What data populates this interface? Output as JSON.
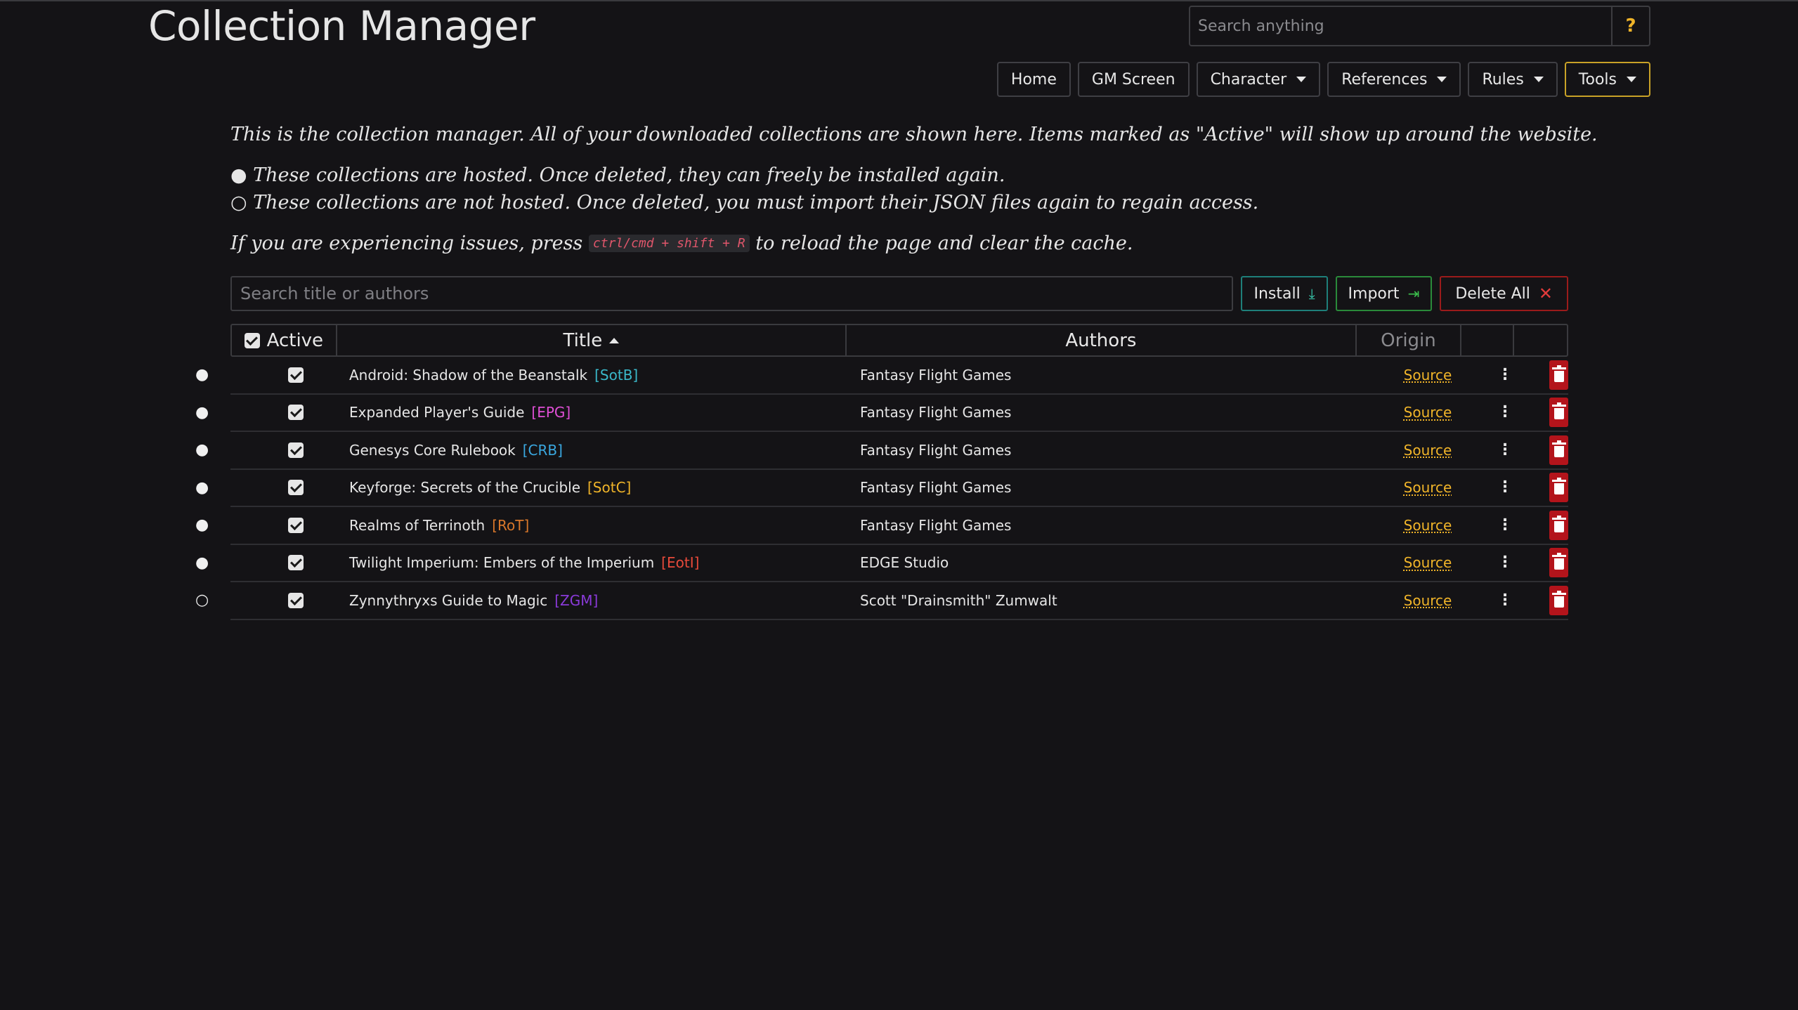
{
  "app": {
    "title": "Collection Manager",
    "search_placeholder": "Search anything",
    "help_label": "?"
  },
  "nav": {
    "items": [
      {
        "label": "Home",
        "dropdown": false
      },
      {
        "label": "GM Screen",
        "dropdown": false
      },
      {
        "label": "Character",
        "dropdown": true
      },
      {
        "label": "References",
        "dropdown": true
      },
      {
        "label": "Rules",
        "dropdown": true
      },
      {
        "label": "Tools",
        "dropdown": true,
        "active": true
      }
    ]
  },
  "intro": {
    "line1": "This is the collection manager. All of your downloaded collections are shown here. Items marked as \"Active\" will show up around the website.",
    "line2": "● These collections are hosted. Once deleted, they can freely be installed again.",
    "line3": "○ These collections are not hosted. Once deleted, you must import their JSON files again to regain access.",
    "line4_before": "If you are experiencing issues, press",
    "line4_key": "ctrl/cmd + shift + R",
    "line4_after": "to reload the page and clear the cache."
  },
  "toolbar": {
    "search_placeholder": "Search title or authors",
    "install_label": "Install",
    "import_label": "Import",
    "delete_all_label": "Delete All"
  },
  "table": {
    "headers": {
      "active": "Active",
      "title": "Title",
      "authors": "Authors",
      "origin": "Origin"
    },
    "rows": [
      {
        "bullet": "●",
        "active": true,
        "title": "Android: Shadow of the Beanstalk",
        "abbr": "[SotB]",
        "abbr_color": "#3ab8c9",
        "authors": "Fantasy Flight Games",
        "origin": "Source"
      },
      {
        "bullet": "●",
        "active": true,
        "title": "Expanded Player's Guide",
        "abbr": "[EPG]",
        "abbr_color": "#e04fd6",
        "authors": "Fantasy Flight Games",
        "origin": "Source"
      },
      {
        "bullet": "●",
        "active": true,
        "title": "Genesys Core Rulebook",
        "abbr": "[CRB]",
        "abbr_color": "#3aa8e0",
        "authors": "Fantasy Flight Games",
        "origin": "Source"
      },
      {
        "bullet": "●",
        "active": true,
        "title": "Keyforge: Secrets of the Crucible",
        "abbr": "[SotC]",
        "abbr_color": "#f0b429",
        "authors": "Fantasy Flight Games",
        "origin": "Source"
      },
      {
        "bullet": "●",
        "active": true,
        "title": "Realms of Terrinoth",
        "abbr": "[RoT]",
        "abbr_color": "#d9772a",
        "authors": "Fantasy Flight Games",
        "origin": "Source"
      },
      {
        "bullet": "●",
        "active": true,
        "title": "Twilight Imperium: Embers of the Imperium",
        "abbr": "[EotI]",
        "abbr_color": "#e84a3a",
        "authors": "EDGE Studio",
        "origin": "Source"
      },
      {
        "bullet": "○",
        "active": true,
        "title": "Zynnythryxs Guide to Magic",
        "abbr": "[ZGM]",
        "abbr_color": "#8a3ad9",
        "authors": "Scott \"Drainsmith\" Zumwalt",
        "origin": "Source"
      }
    ]
  }
}
